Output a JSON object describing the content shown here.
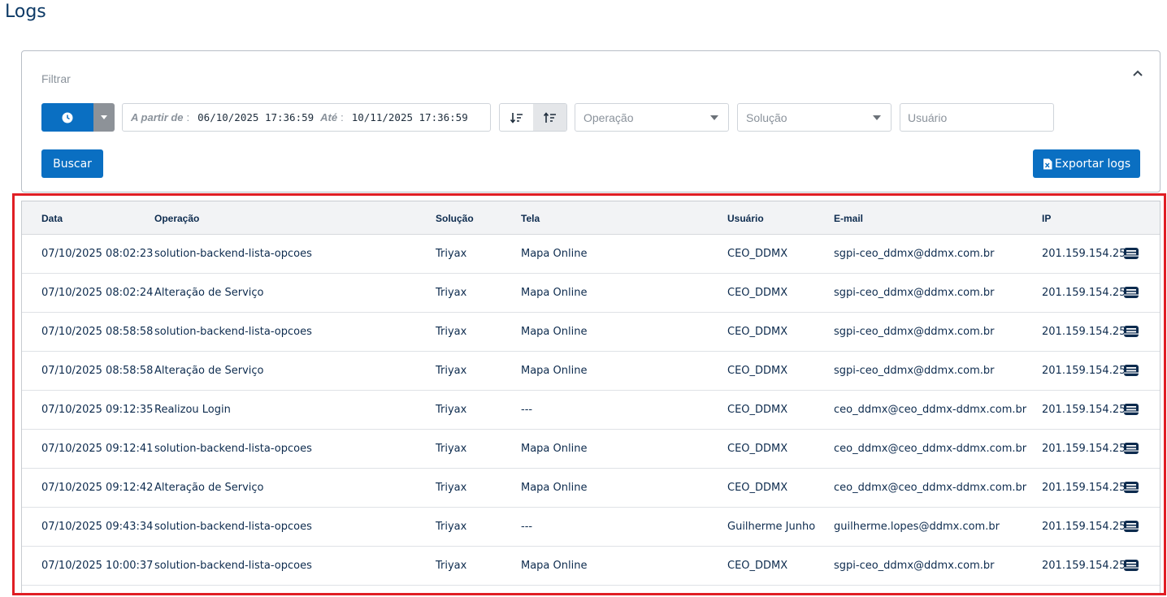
{
  "page": {
    "title": "Logs"
  },
  "filter": {
    "label": "Filtrar",
    "date_from_label": "A partir de",
    "date_from_value": "06/10/2025 17:36:59",
    "date_to_label": "Até",
    "date_to_value": "10/11/2025 17:36:59",
    "operation_placeholder": "Operação",
    "solution_placeholder": "Solução",
    "user_placeholder": "Usuário",
    "search_label": "Buscar",
    "export_label": "Exportar logs"
  },
  "colors": {
    "primary": "#0a6fc2",
    "highlight": "#e01e24",
    "text": "#0d2b4e"
  },
  "table": {
    "headers": {
      "date": "Data",
      "operation": "Operação",
      "solution": "Solução",
      "screen": "Tela",
      "user": "Usuário",
      "email": "E-mail",
      "ip": "IP"
    },
    "rows": [
      {
        "date": "07/10/2025 08:02:23",
        "operation": "solution-backend-lista-opcoes",
        "solution": "Triyax",
        "screen": "Mapa Online",
        "user": "CEO_DDMX",
        "email": "sgpi-ceo_ddmx@ddmx.com.br",
        "ip": "201.159.154.254"
      },
      {
        "date": "07/10/2025 08:02:24",
        "operation": "Alteração de Serviço",
        "solution": "Triyax",
        "screen": "Mapa Online",
        "user": "CEO_DDMX",
        "email": "sgpi-ceo_ddmx@ddmx.com.br",
        "ip": "201.159.154.254"
      },
      {
        "date": "07/10/2025 08:58:58",
        "operation": "solution-backend-lista-opcoes",
        "solution": "Triyax",
        "screen": "Mapa Online",
        "user": "CEO_DDMX",
        "email": "sgpi-ceo_ddmx@ddmx.com.br",
        "ip": "201.159.154.254"
      },
      {
        "date": "07/10/2025 08:58:58",
        "operation": "Alteração de Serviço",
        "solution": "Triyax",
        "screen": "Mapa Online",
        "user": "CEO_DDMX",
        "email": "sgpi-ceo_ddmx@ddmx.com.br",
        "ip": "201.159.154.254"
      },
      {
        "date": "07/10/2025 09:12:35",
        "operation": "Realizou Login",
        "solution": "Triyax",
        "screen": "---",
        "user": "CEO_DDMX",
        "email": "ceo_ddmx@ceo_ddmx-ddmx.com.br",
        "ip": "201.159.154.254"
      },
      {
        "date": "07/10/2025 09:12:41",
        "operation": "solution-backend-lista-opcoes",
        "solution": "Triyax",
        "screen": "Mapa Online",
        "user": "CEO_DDMX",
        "email": "ceo_ddmx@ceo_ddmx-ddmx.com.br",
        "ip": "201.159.154.254"
      },
      {
        "date": "07/10/2025 09:12:42",
        "operation": "Alteração de Serviço",
        "solution": "Triyax",
        "screen": "Mapa Online",
        "user": "CEO_DDMX",
        "email": "ceo_ddmx@ceo_ddmx-ddmx.com.br",
        "ip": "201.159.154.254"
      },
      {
        "date": "07/10/2025 09:43:34",
        "operation": "solution-backend-lista-opcoes",
        "solution": "Triyax",
        "screen": "---",
        "user": "Guilherme Junho",
        "email": "guilherme.lopes@ddmx.com.br",
        "ip": "201.159.154.254"
      },
      {
        "date": "07/10/2025 10:00:37",
        "operation": "solution-backend-lista-opcoes",
        "solution": "Triyax",
        "screen": "Mapa Online",
        "user": "CEO_DDMX",
        "email": "sgpi-ceo_ddmx@ddmx.com.br",
        "ip": "201.159.154.254"
      }
    ]
  }
}
